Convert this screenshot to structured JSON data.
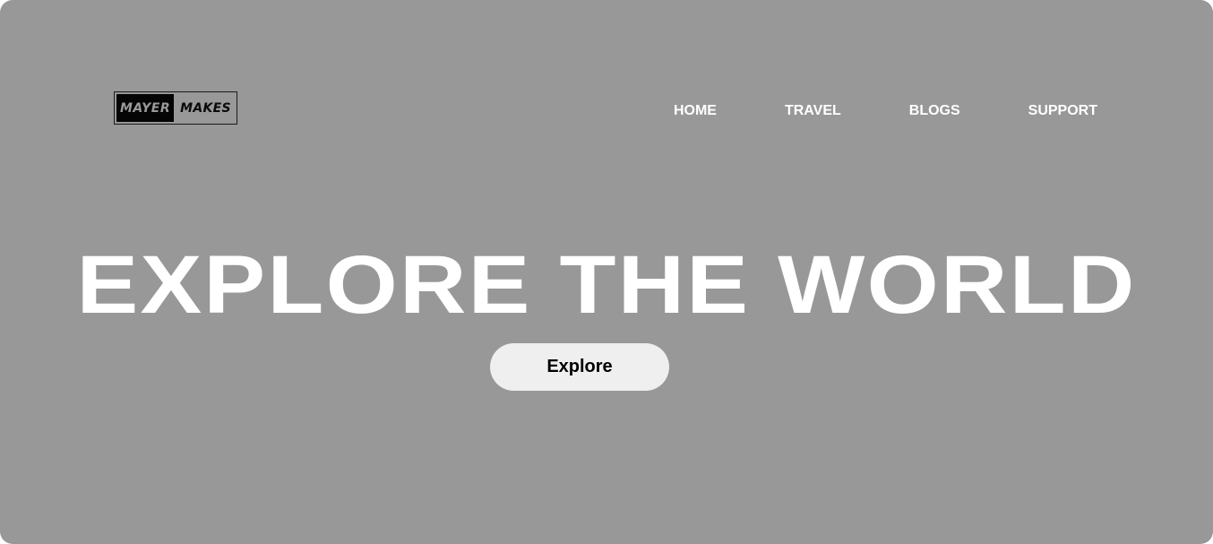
{
  "logo": {
    "part1": "MAYER",
    "part2": "MAKES"
  },
  "nav": {
    "items": [
      {
        "label": "HOME"
      },
      {
        "label": "TRAVEL"
      },
      {
        "label": "BLOGS"
      },
      {
        "label": "SUPPORT"
      }
    ]
  },
  "hero": {
    "title": "EXPLORE THE WORLD",
    "button_label": "Explore"
  },
  "colors": {
    "background": "#989898",
    "text": "#ffffff",
    "button_bg": "#efefef",
    "logo_dark": "#050505"
  }
}
